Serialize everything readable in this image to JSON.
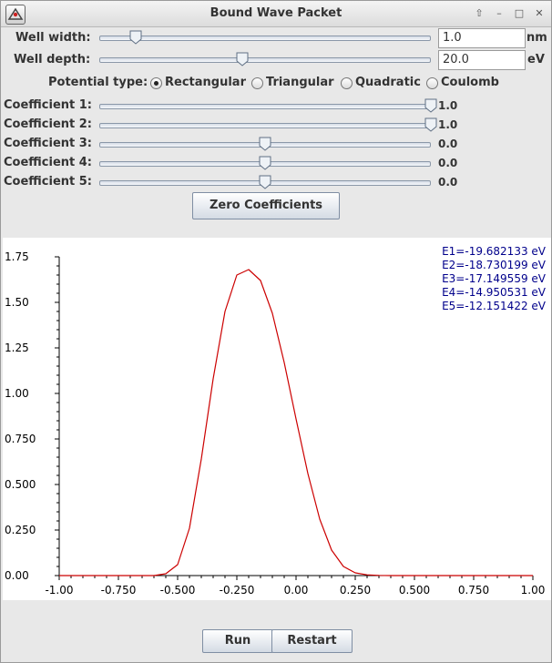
{
  "window": {
    "title": "Bound Wave Packet",
    "controls": [
      "⇧",
      "–",
      "□",
      "✕"
    ]
  },
  "well": {
    "width_label": "Well width:",
    "width_value": "1.0",
    "width_unit": "nm",
    "width_slider_fraction": 0.11,
    "depth_label": "Well depth:",
    "depth_value": "20.0",
    "depth_unit": "eV",
    "depth_slider_fraction": 0.43
  },
  "potential": {
    "label": "Potential type:",
    "options": [
      "Rectangular",
      "Triangular",
      "Quadratic",
      "Coulomb"
    ],
    "selected": "Rectangular"
  },
  "coefficients": [
    {
      "label": "Coefficient 1:",
      "value": "1.0",
      "fraction": 1.0
    },
    {
      "label": "Coefficient 2:",
      "value": "1.0",
      "fraction": 1.0
    },
    {
      "label": "Coefficient 3:",
      "value": "0.0",
      "fraction": 0.5
    },
    {
      "label": "Coefficient 4:",
      "value": "0.0",
      "fraction": 0.5
    },
    {
      "label": "Coefficient 5:",
      "value": "0.0",
      "fraction": 0.5
    }
  ],
  "buttons": {
    "zero": "Zero Coefficients",
    "run": "Run",
    "restart": "Restart"
  },
  "energies": [
    "E1=-19.682133 eV",
    "E2=-18.730199 eV",
    "E3=-17.149559 eV",
    "E4=-14.950531 eV",
    "E5=-12.151422 eV"
  ],
  "chart_data": {
    "type": "line",
    "series": [
      {
        "color": "#cc0000",
        "x": [
          -1.0,
          -0.8,
          -0.6,
          -0.55,
          -0.5,
          -0.45,
          -0.4,
          -0.35,
          -0.3,
          -0.25,
          -0.2,
          -0.15,
          -0.1,
          -0.05,
          0.0,
          0.05,
          0.1,
          0.15,
          0.2,
          0.25,
          0.3,
          0.35,
          0.4,
          0.6,
          0.8,
          1.0
        ],
        "y": [
          0.0,
          0.0,
          0.0,
          0.01,
          0.06,
          0.26,
          0.64,
          1.08,
          1.45,
          1.65,
          1.68,
          1.62,
          1.44,
          1.17,
          0.86,
          0.56,
          0.31,
          0.14,
          0.05,
          0.015,
          0.004,
          0.001,
          0.0,
          0.0,
          0.0,
          0.0
        ]
      }
    ],
    "xlim": [
      -1.0,
      1.0
    ],
    "ylim": [
      0.0,
      1.75
    ],
    "xticks": [
      "-1.00",
      "-0.750",
      "-0.500",
      "-0.250",
      "0.00",
      "0.250",
      "0.500",
      "0.750",
      "1.00"
    ],
    "yticks": [
      "0.00",
      "0.250",
      "0.500",
      "0.750",
      "1.00",
      "1.25",
      "1.50",
      "1.75"
    ],
    "grid": false
  }
}
